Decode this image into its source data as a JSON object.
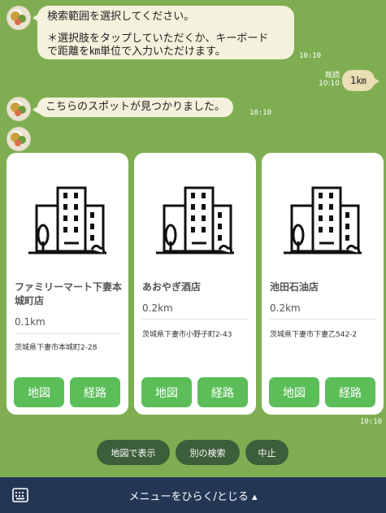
{
  "messages": {
    "bot1_line1": "検索範囲を選択してください。",
    "bot1_line2": "＊選択肢をタップしていただくか、キーボード",
    "bot1_line3": "で距離を㎞単位で入力いただけます。",
    "bot1_time": "10:10",
    "user_read": "既読",
    "user_time": "10:10",
    "user_text": "1㎞",
    "bot2_text": "こちらのスポットが見つかりました。",
    "bot2_time": "10:10",
    "cards_time": "10:10"
  },
  "cards": [
    {
      "name": "ファミリーマート下妻本城町店",
      "distance": "0.1km",
      "address": "茨城県下妻市本城町2-28",
      "map_label": "地図",
      "route_label": "経路"
    },
    {
      "name": "あおやぎ酒店",
      "distance": "0.2km",
      "address": "茨城県下妻市小野子町2-43",
      "map_label": "地図",
      "route_label": "経路"
    },
    {
      "name": "池田石油店",
      "distance": "0.2km",
      "address": "茨城県下妻市下妻乙542-2",
      "map_label": "地図",
      "route_label": "経路"
    }
  ],
  "quick_replies": [
    "地図で表示",
    "別の検索",
    "中止"
  ],
  "menu": {
    "label": "メニューをひらく/とじる ▴",
    "keyboard_icon": "keyboard-icon"
  },
  "colors": {
    "background": "#7fae52",
    "bubble": "#f4f1dc",
    "button": "#5bbe59",
    "quick_reply": "#3d5e3a",
    "menu_bar": "#233755"
  }
}
